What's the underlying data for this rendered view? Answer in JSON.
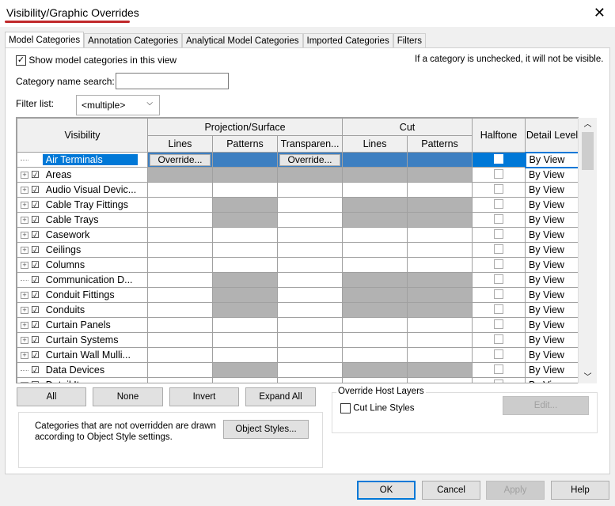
{
  "window": {
    "title": "Visibility/Graphic Overrides",
    "close": "✕"
  },
  "tabs": [
    "Model Categories",
    "Annotation Categories",
    "Analytical Model Categories",
    "Imported Categories",
    "Filters"
  ],
  "show_checkbox": {
    "label": "Show model categories in this view",
    "checked": true
  },
  "hint": "If a category is unchecked, it will not be visible.",
  "search": {
    "label": "Category name search:",
    "value": ""
  },
  "filter": {
    "label": "Filter list:",
    "value": "<multiple>"
  },
  "table": {
    "headers": {
      "visibility": "Visibility",
      "projection": "Projection/Surface",
      "cut": "Cut",
      "halftone": "Halftone",
      "detail": "Detail Level",
      "lines": "Lines",
      "patterns": "Patterns",
      "transparency": "Transparen...",
      "cut_lines": "Lines",
      "cut_patterns": "Patterns"
    },
    "override_label": "Override...",
    "rows": [
      {
        "name": "Air Terminals",
        "expandable": false,
        "hatch": [
          0,
          0,
          0,
          0,
          0
        ],
        "detail": "By View",
        "selected": true
      },
      {
        "name": "Areas",
        "expandable": true,
        "hatch": [
          1,
          1,
          1,
          1,
          1
        ],
        "detail": "By View"
      },
      {
        "name": "Audio Visual Devic...",
        "expandable": true,
        "hatch": [
          0,
          0,
          0,
          0,
          0
        ],
        "detail": "By View"
      },
      {
        "name": "Cable Tray Fittings",
        "expandable": true,
        "hatch": [
          0,
          1,
          0,
          1,
          1
        ],
        "detail": "By View"
      },
      {
        "name": "Cable Trays",
        "expandable": true,
        "hatch": [
          0,
          1,
          0,
          1,
          1
        ],
        "detail": "By View"
      },
      {
        "name": "Casework",
        "expandable": true,
        "hatch": [
          0,
          0,
          0,
          0,
          0
        ],
        "detail": "By View"
      },
      {
        "name": "Ceilings",
        "expandable": true,
        "hatch": [
          0,
          0,
          0,
          0,
          0
        ],
        "detail": "By View"
      },
      {
        "name": "Columns",
        "expandable": true,
        "hatch": [
          0,
          0,
          0,
          0,
          0
        ],
        "detail": "By View"
      },
      {
        "name": "Communication D...",
        "expandable": false,
        "hatch": [
          0,
          1,
          0,
          1,
          1
        ],
        "detail": "By View"
      },
      {
        "name": "Conduit Fittings",
        "expandable": true,
        "hatch": [
          0,
          1,
          0,
          1,
          1
        ],
        "detail": "By View"
      },
      {
        "name": "Conduits",
        "expandable": true,
        "hatch": [
          0,
          1,
          0,
          1,
          1
        ],
        "detail": "By View"
      },
      {
        "name": "Curtain Panels",
        "expandable": true,
        "hatch": [
          0,
          0,
          0,
          0,
          0
        ],
        "detail": "By View"
      },
      {
        "name": "Curtain Systems",
        "expandable": true,
        "hatch": [
          0,
          0,
          0,
          0,
          0
        ],
        "detail": "By View"
      },
      {
        "name": "Curtain Wall Mulli...",
        "expandable": true,
        "hatch": [
          0,
          0,
          0,
          0,
          0
        ],
        "detail": "By View"
      },
      {
        "name": "Data Devices",
        "expandable": false,
        "hatch": [
          0,
          1,
          0,
          1,
          1
        ],
        "detail": "By View"
      },
      {
        "name": "Detail Items",
        "expandable": true,
        "hatch": [
          0,
          0,
          0,
          0,
          0
        ],
        "detail": "By View"
      }
    ]
  },
  "buttons": {
    "all": "All",
    "none": "None",
    "invert": "Invert",
    "expand_all": "Expand All",
    "object_styles": "Object Styles...",
    "edit": "Edit...",
    "ok": "OK",
    "cancel": "Cancel",
    "apply": "Apply",
    "help": "Help"
  },
  "info_text": "Categories that are not overridden are drawn according to Object Style settings.",
  "host_layers": {
    "title": "Override Host Layers",
    "cut_line_styles": "Cut Line Styles",
    "checked": false
  }
}
